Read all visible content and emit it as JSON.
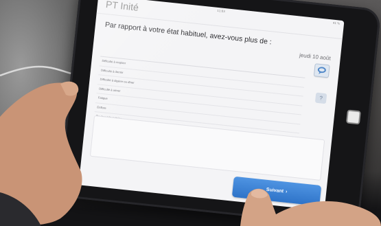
{
  "app": {
    "title": "PT Inité",
    "status_time": "11:03",
    "status_battery": "41 %"
  },
  "question": {
    "text": "Par rapport à votre état habituel, avez-vous plus de :",
    "date": "jeudi 10 août"
  },
  "symptoms": [
    "Difficulté à respirer",
    "Difficulté à dormir",
    "Difficulté à digérer ou dîner",
    "Difficulté à uriner",
    "Fatigue",
    "Enflure",
    "Douleur à la poitrine"
  ],
  "buttons": {
    "chat_icon": "speech-bubble-icon",
    "help_label": "?",
    "next_label": "Suivant",
    "next_arrow": "›"
  },
  "colors": {
    "accent_blue": "#3a82d6",
    "screen_background": "#f4f4f6",
    "tablet_case": "#151517"
  }
}
